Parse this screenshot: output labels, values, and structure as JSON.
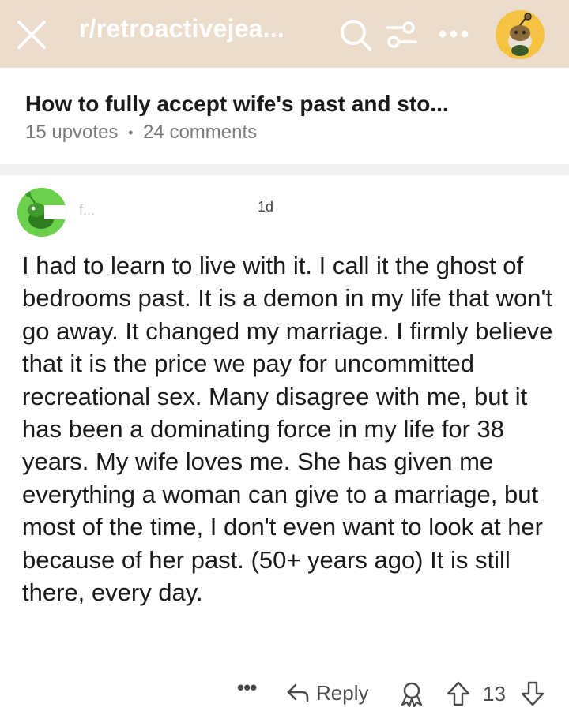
{
  "header": {
    "subreddit": "r/retroactivejea...",
    "background_color": "#ecdccb",
    "icons": [
      "close-icon",
      "search-icon",
      "filter-icon",
      "more-icon",
      "snoo-avatar-icon"
    ]
  },
  "post": {
    "title": "How to fully accept wife's past and sto...",
    "upvotes": "15 upvotes",
    "separator": "•",
    "comments": "24 comments"
  },
  "comment": {
    "author": "f...",
    "age": "1d",
    "avatar_color": "#6bd14c",
    "body": "I had to learn to live with it. I call it the ghost of bedrooms past. It is a demon in my life that won't go away. It changed my marriage. I firmly believe that it is the price we pay for uncommitted recreational sex. Many disagree with me, but it has been a dominating force in my life for 38 years. My wife loves me. She has given me everything a woman can give to a marriage, but most of the time, I don't even want to look at her because of her past. (50+ years ago) It is still there, every day.",
    "actions": {
      "more": "•••",
      "reply": "Reply",
      "score": "13"
    }
  }
}
